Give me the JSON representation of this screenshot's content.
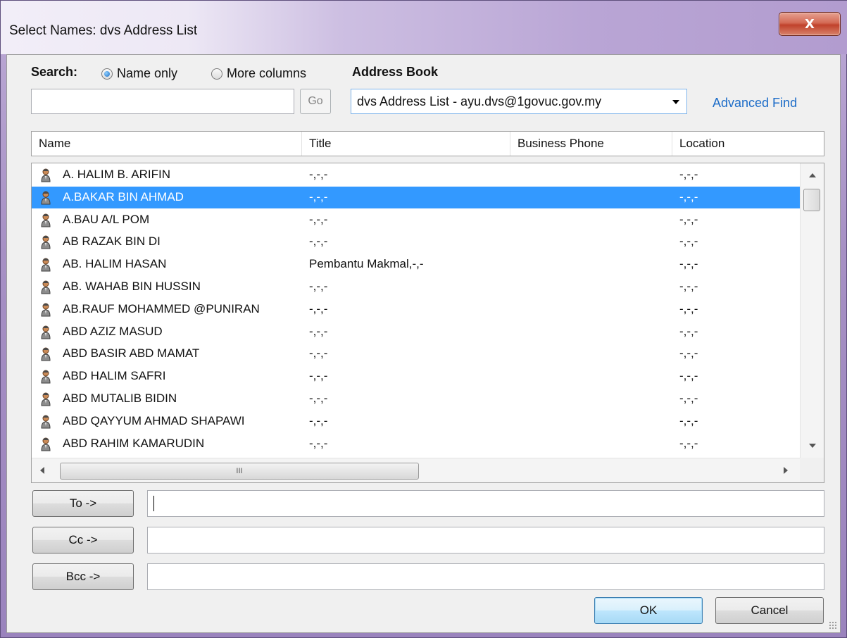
{
  "window": {
    "title": "Select Names: dvs Address List",
    "close_glyph": "X"
  },
  "search": {
    "label": "Search:",
    "options": [
      {
        "label": "Name only",
        "selected": true
      },
      {
        "label": "More columns",
        "selected": false
      }
    ],
    "input_value": "",
    "go_label": "Go"
  },
  "address_book": {
    "label": "Address Book",
    "selected": "dvs Address List - ayu.dvs@1govuc.gov.my",
    "advanced_find": "Advanced Find"
  },
  "columns": [
    "Name",
    "Title",
    "Business Phone",
    "Location"
  ],
  "rows": [
    {
      "name": "A. HALIM B. ARIFIN",
      "title": "-,-,-",
      "phone": "",
      "location": "-,-,-",
      "selected": false
    },
    {
      "name": "A.BAKAR BIN AHMAD",
      "title": "-,-,-",
      "phone": "",
      "location": "-,-,-",
      "selected": true
    },
    {
      "name": "A.BAU A/L POM",
      "title": "-,-,-",
      "phone": "",
      "location": "-,-,-",
      "selected": false
    },
    {
      "name": "AB RAZAK BIN DI",
      "title": "-,-,-",
      "phone": "",
      "location": "-,-,-",
      "selected": false
    },
    {
      "name": "AB. HALIM HASAN",
      "title": "Pembantu Makmal,-,-",
      "phone": "",
      "location": "-,-,-",
      "selected": false
    },
    {
      "name": "AB. WAHAB BIN HUSSIN",
      "title": "-,-,-",
      "phone": "",
      "location": "-,-,-",
      "selected": false
    },
    {
      "name": "AB.RAUF MOHAMMED @PUNIRAN",
      "title": "-,-,-",
      "phone": "",
      "location": "-,-,-",
      "selected": false
    },
    {
      "name": "ABD AZIZ MASUD",
      "title": "-,-,-",
      "phone": "",
      "location": "-,-,-",
      "selected": false
    },
    {
      "name": "ABD BASIR ABD MAMAT",
      "title": "-,-,-",
      "phone": "",
      "location": "-,-,-",
      "selected": false
    },
    {
      "name": "ABD HALIM SAFRI",
      "title": "-,-,-",
      "phone": "",
      "location": "-,-,-",
      "selected": false
    },
    {
      "name": "ABD MUTALIB BIDIN",
      "title": "-,-,-",
      "phone": "",
      "location": "-,-,-",
      "selected": false
    },
    {
      "name": "ABD QAYYUM AHMAD SHAPAWI",
      "title": "-,-,-",
      "phone": "",
      "location": "-,-,-",
      "selected": false
    },
    {
      "name": "ABD RAHIM KAMARUDIN",
      "title": "-,-,-",
      "phone": "",
      "location": "-,-,-",
      "selected": false
    }
  ],
  "hscroll_thumb_glyph": "III",
  "recipients": {
    "to_label": "To ->",
    "cc_label": "Cc ->",
    "bcc_label": "Bcc ->",
    "to_value": "",
    "cc_value": "",
    "bcc_value": ""
  },
  "actions": {
    "ok": "OK",
    "cancel": "Cancel"
  },
  "icons": {
    "contact": "person-icon",
    "close": "close-icon"
  },
  "colors": {
    "selection": "#3399ff",
    "link": "#1c6cc8"
  }
}
